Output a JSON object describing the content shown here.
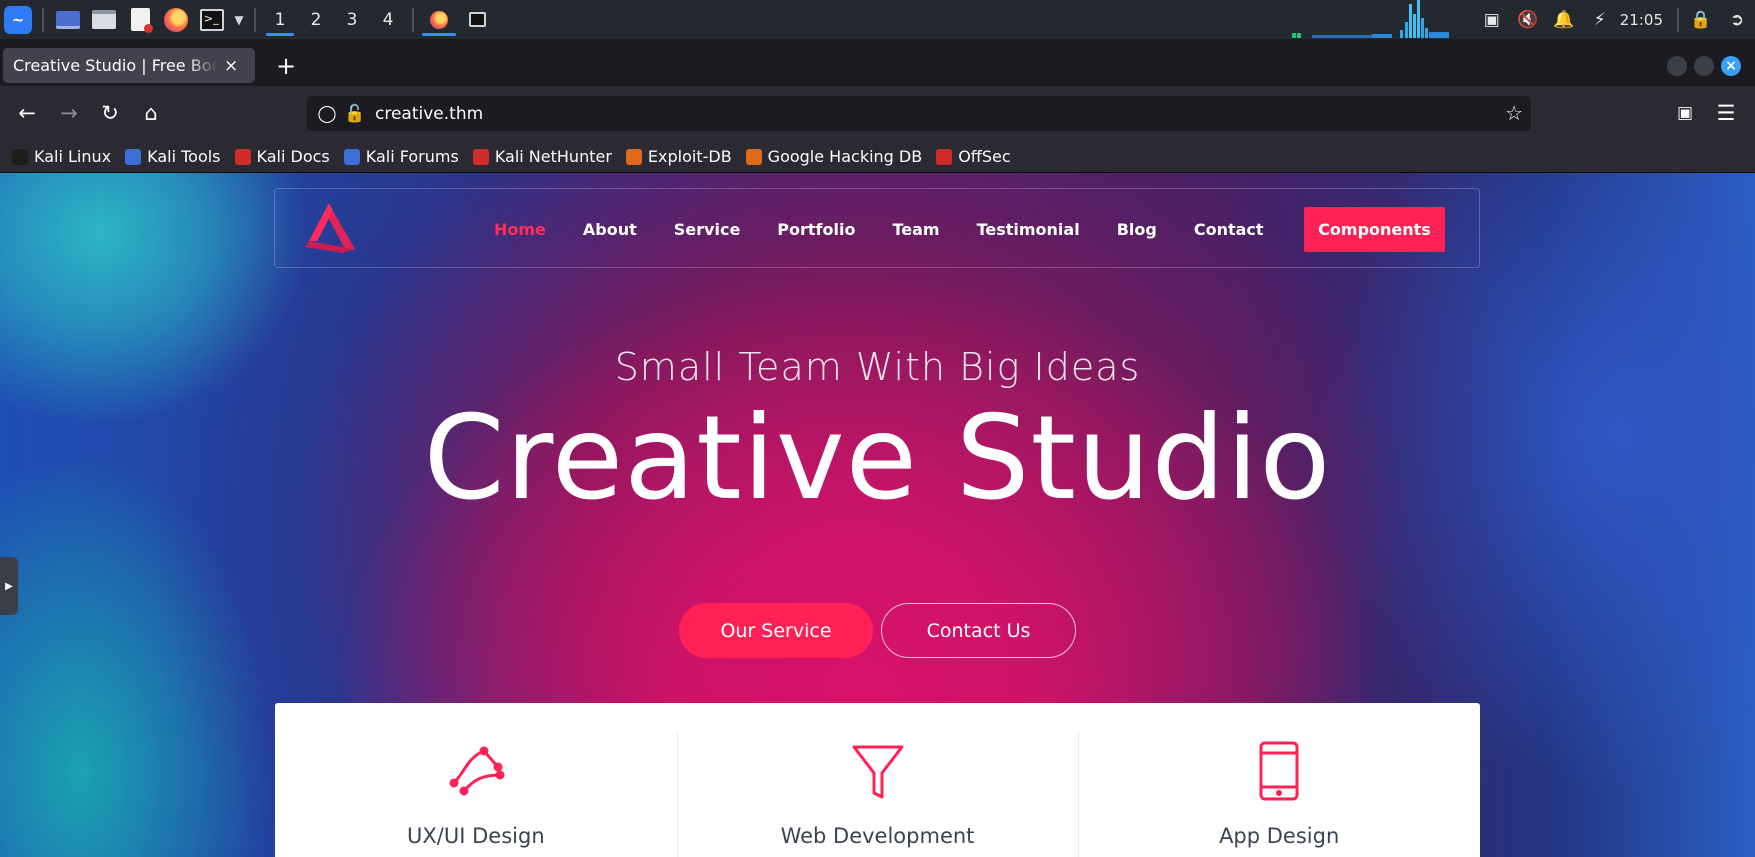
{
  "panel": {
    "workspaces": [
      "1",
      "2",
      "3",
      "4"
    ],
    "active_workspace": "1",
    "clock": "21:05",
    "launchers": [
      "kali-menu",
      "show-desktop",
      "file-manager",
      "text-editor",
      "firefox",
      "terminal"
    ]
  },
  "browser": {
    "tab_title": "Creative Studio | Free Bootstrap",
    "new_tab": "+",
    "tab_close": "×",
    "url": "creative.thm",
    "bookmarks": [
      {
        "label": "Kali Linux",
        "color": "#1d1d1d"
      },
      {
        "label": "Kali Tools",
        "color": "#3b6fd6"
      },
      {
        "label": "Kali Docs",
        "color": "#d22b2b"
      },
      {
        "label": "Kali Forums",
        "color": "#3b6fd6"
      },
      {
        "label": "Kali NetHunter",
        "color": "#d22b2b"
      },
      {
        "label": "Exploit-DB",
        "color": "#e06a1b"
      },
      {
        "label": "Google Hacking DB",
        "color": "#e06a1b"
      },
      {
        "label": "OffSec",
        "color": "#d22b2b"
      }
    ]
  },
  "site": {
    "accent": "#ff2156",
    "nav": [
      "Home",
      "About",
      "Service",
      "Portfolio",
      "Team",
      "Testimonial",
      "Blog",
      "Contact"
    ],
    "nav_active": "Home",
    "components_button": "Components",
    "tagline": "Small Team With Big Ideas",
    "hero_title": "Creative Studio",
    "primary_button": "Our Service",
    "secondary_button": "Contact Us",
    "features": [
      {
        "title": "UX/UI Design",
        "icon": "bezier-pen-icon"
      },
      {
        "title": "Web Development",
        "icon": "funnel-icon"
      },
      {
        "title": "App Design",
        "icon": "tablet-icon"
      }
    ]
  }
}
